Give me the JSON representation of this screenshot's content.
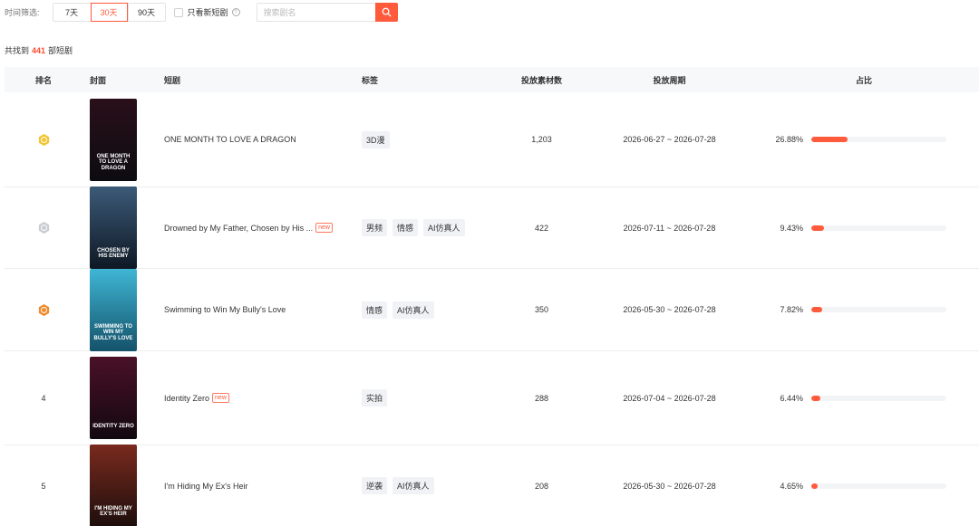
{
  "filter": {
    "label": "时间筛选:",
    "options": [
      "7天",
      "30天",
      "90天"
    ],
    "active_index": 1,
    "checkbox_label": "只看新短剧",
    "search_placeholder": "搜索剧名"
  },
  "result": {
    "prefix": "共找到",
    "count": "441",
    "suffix": "部短剧"
  },
  "columns": {
    "rank": "排名",
    "cover": "封面",
    "title": "短剧",
    "tags": "标签",
    "count": "投放素材数",
    "period": "投放周期",
    "share": "占比"
  },
  "rows": [
    {
      "rank": "",
      "medal": "gold",
      "cover_text": "ONE MONTH TO LOVE A DRAGON",
      "cover_colors": [
        "#2a0f1a",
        "#0c0c10"
      ],
      "title": "ONE MONTH TO LOVE A DRAGON",
      "is_new": false,
      "tags": [
        "3D漫"
      ],
      "count": "1,203",
      "period": "2026-06-27 ~ 2026-07-28",
      "share": "26.88%",
      "share_value": 26.88
    },
    {
      "rank": "",
      "medal": "silver",
      "cover_text": "CHOSEN BY HIS ENEMY",
      "cover_colors": [
        "#3c5a78",
        "#0e1824"
      ],
      "title": "Drowned by My Father, Chosen by His ...",
      "is_new": true,
      "tags": [
        "男频",
        "情感",
        "AI仿真人"
      ],
      "count": "422",
      "period": "2026-07-11 ~ 2026-07-28",
      "share": "9.43%",
      "share_value": 9.43
    },
    {
      "rank": "",
      "medal": "bronze",
      "cover_text": "SWIMMING TO WIN MY BULLY'S LOVE",
      "cover_colors": [
        "#3fb6d4",
        "#14526a"
      ],
      "title": "Swimming to Win My Bully's Love",
      "is_new": false,
      "tags": [
        "情感",
        "AI仿真人"
      ],
      "count": "350",
      "period": "2026-05-30 ~ 2026-07-28",
      "share": "7.82%",
      "share_value": 7.82
    },
    {
      "rank": "4",
      "medal": "",
      "cover_text": "IDENTITY ZERO",
      "cover_colors": [
        "#4a1028",
        "#120810"
      ],
      "title": "Identity Zero",
      "is_new": true,
      "tags": [
        "实拍"
      ],
      "count": "288",
      "period": "2026-07-04 ~ 2026-07-28",
      "share": "6.44%",
      "share_value": 6.44
    },
    {
      "rank": "5",
      "medal": "",
      "cover_text": "I'M HIDING MY EX'S HEIR",
      "cover_colors": [
        "#7a2a1e",
        "#1c0e0c"
      ],
      "title": "I'm Hiding My Ex's Heir",
      "is_new": false,
      "tags": [
        "逆袭",
        "AI仿真人"
      ],
      "count": "208",
      "period": "2026-05-30 ~ 2026-07-28",
      "share": "4.65%",
      "share_value": 4.65
    }
  ],
  "new_badge_label": "new",
  "colors": {
    "accent": "#ff5a3c",
    "gold": "#f2c531",
    "silver": "#c9ccd1",
    "bronze": "#f08a2c"
  }
}
